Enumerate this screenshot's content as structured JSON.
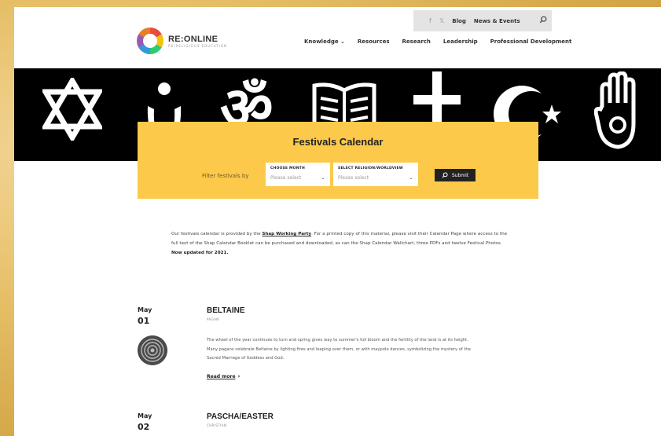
{
  "utility": {
    "social": [
      "f",
      "𝕏"
    ],
    "blog": "Blog",
    "news": "News & Events"
  },
  "logo": {
    "name": "RE:ONLINE",
    "tagline": "RE/RELIGIOUS EDUCATION"
  },
  "nav": [
    "Knowledge",
    "Resources",
    "Research",
    "Leadership",
    "Professional Development"
  ],
  "hero": {
    "background": "#000000",
    "symbols": [
      "star-of-david-icon",
      "humanist-icon",
      "om-icon",
      "book-icon",
      "cross-icon",
      "crescent-star-icon",
      "jain-hand-icon"
    ]
  },
  "calendar": {
    "title": "Festivals Calendar",
    "filter_label": "Filter festivals by",
    "month": {
      "label": "CHOOSE MONTH",
      "placeholder": "Please select"
    },
    "religion": {
      "label": "SELECT RELIGION/WORLDVIEW",
      "placeholder": "Please select"
    },
    "submit": "Submit",
    "accent": "#fcc94a"
  },
  "intro": {
    "pre": "Our festivals calendar is provided by the ",
    "link": "Shap Working Party",
    "post": ". For a printed copy of this material, please visit their Calendar Page where access to the full text of the Shap Calendar Booklet can be purchased and downloaded, as can the Shap Calendar Wallchart, three PDFs and twelve Festival Photos. ",
    "updated": "Now updated for 2021."
  },
  "festivals": [
    {
      "month": "May",
      "day": "01",
      "name": "BELTAINE",
      "tradition": "PAGAN",
      "description": "The wheel of the year continues to turn and spring gives way to summer's full bloom and the fertility of the land is at its height. Many pagans celebrate Beltaine by lighting fires and leaping over them, or with maypole dances, symbolizing the mystery of the Sacred Marriage of Goddess and God.",
      "read_more": "Read more"
    },
    {
      "month": "May",
      "day": "02",
      "name": "PASCHA/EASTER",
      "tradition": "CHRISTIAN"
    }
  ]
}
